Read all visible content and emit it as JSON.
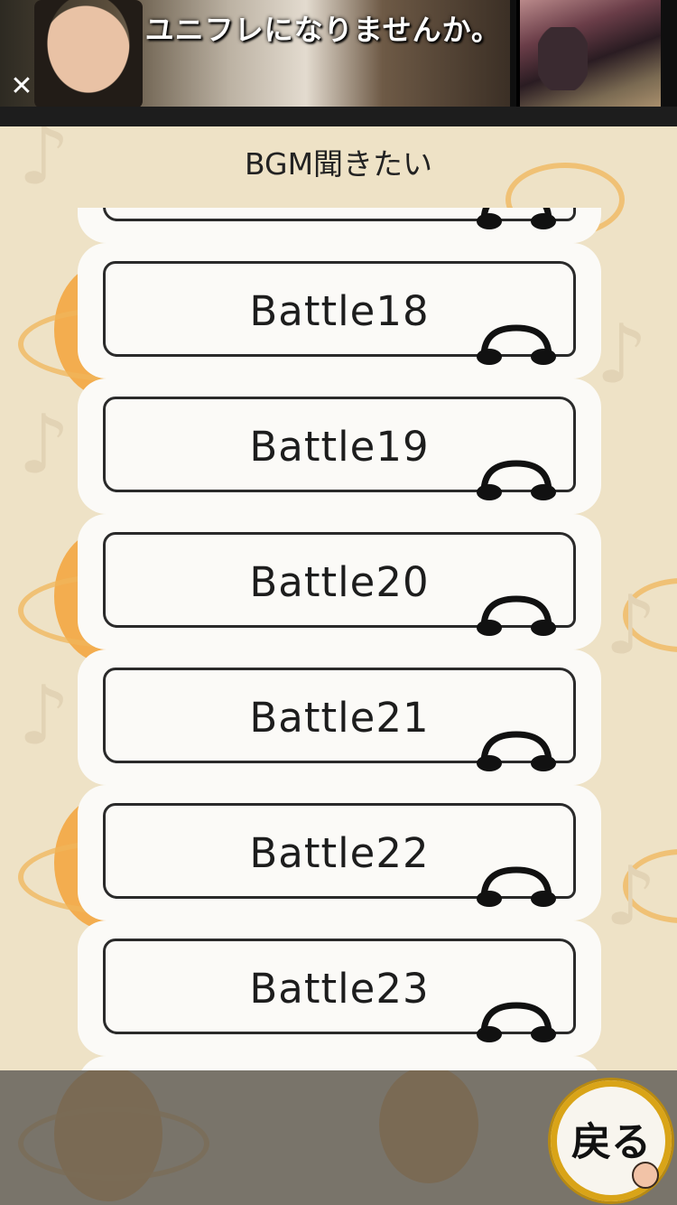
{
  "ad": {
    "headline": "ユニフレになりませんか。",
    "close_glyph": "✕"
  },
  "header": {
    "title": "BGM聞きたい"
  },
  "tracks": [
    {
      "label": "Battle18"
    },
    {
      "label": "Battle19"
    },
    {
      "label": "Battle20"
    },
    {
      "label": "Battle21"
    },
    {
      "label": "Battle22"
    },
    {
      "label": "Battle23"
    }
  ],
  "footer": {
    "back_label": "戻る"
  },
  "colors": {
    "accent_gold": "#d9a418",
    "ring_orange": "#f0b55a",
    "background": "#eee2c6"
  }
}
